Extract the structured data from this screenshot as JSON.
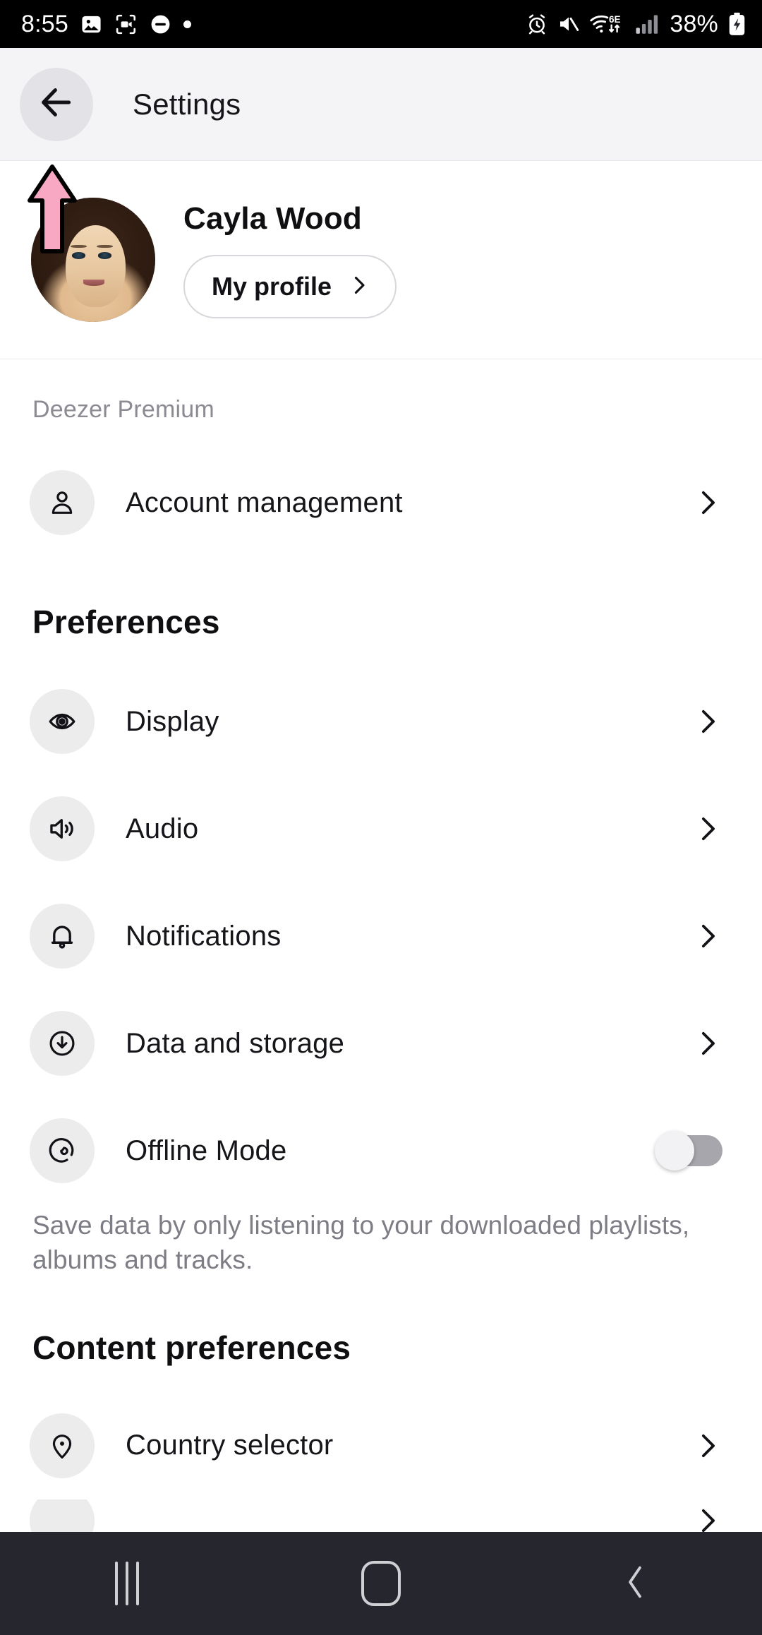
{
  "status_bar": {
    "time": "8:55",
    "left_icons": [
      "image-icon",
      "screen-record-icon",
      "do-not-disturb-icon",
      "dot-icon"
    ],
    "right_icons": [
      "alarm-icon",
      "mute-icon",
      "wifi-6e-icon",
      "cell-signal-icon"
    ],
    "battery_percent": "38%",
    "battery_state": "charging"
  },
  "app_bar": {
    "title": "Settings",
    "back_icon": "arrow-left-icon"
  },
  "profile": {
    "name": "Cayla Wood",
    "button_label": "My profile",
    "button_icon": "chevron-right-icon",
    "avatar_alt": "user-avatar"
  },
  "annotation": {
    "type": "arrow-up",
    "color": "#F9A8C3",
    "points_to": "back-button"
  },
  "sections": [
    {
      "subtitle": "Deezer Premium",
      "heading": null,
      "rows": [
        {
          "label": "Account management",
          "icon": "person-icon",
          "trailing": "chevron"
        }
      ]
    },
    {
      "subtitle": null,
      "heading": "Preferences",
      "rows": [
        {
          "label": "Display",
          "icon": "eye-icon",
          "trailing": "chevron"
        },
        {
          "label": "Audio",
          "icon": "speaker-icon",
          "trailing": "chevron"
        },
        {
          "label": "Notifications",
          "icon": "bell-icon",
          "trailing": "chevron"
        },
        {
          "label": "Data and storage",
          "icon": "download-circle-icon",
          "trailing": "chevron"
        },
        {
          "label": "Offline Mode",
          "icon": "offline-icon",
          "trailing": "toggle",
          "toggle_on": false
        }
      ],
      "description": "Save data by only listening to your downloaded playlists, albums and tracks."
    },
    {
      "subtitle": null,
      "heading": "Content preferences",
      "rows": [
        {
          "label": "Country selector",
          "icon": "location-pin-icon",
          "trailing": "chevron"
        }
      ]
    }
  ],
  "nav_bar": {
    "recents_label": "recents-icon",
    "home_label": "home-icon",
    "back_label": "back-icon"
  },
  "colors": {
    "accent_pink": "#F9A8C3",
    "icon_bg": "#ECECED",
    "appbar_bg": "#F4F4F7",
    "nav_bg": "#25262E",
    "muted_text": "#8B8B93"
  }
}
